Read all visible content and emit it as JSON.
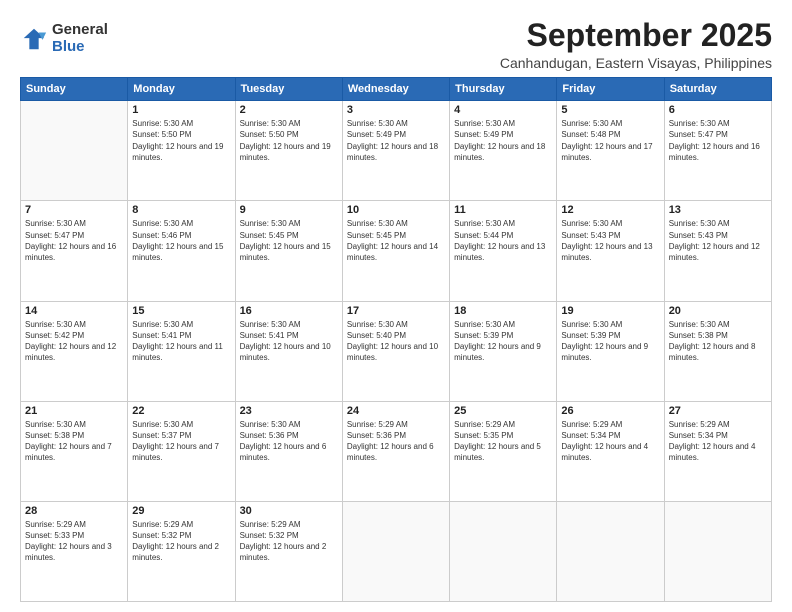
{
  "logo": {
    "general": "General",
    "blue": "Blue"
  },
  "header": {
    "title": "September 2025",
    "subtitle": "Canhandugan, Eastern Visayas, Philippines"
  },
  "days_of_week": [
    "Sunday",
    "Monday",
    "Tuesday",
    "Wednesday",
    "Thursday",
    "Friday",
    "Saturday"
  ],
  "weeks": [
    [
      {
        "day": "",
        "sunrise": "",
        "sunset": "",
        "daylight": ""
      },
      {
        "day": "1",
        "sunrise": "5:30 AM",
        "sunset": "5:50 PM",
        "daylight": "12 hours and 19 minutes."
      },
      {
        "day": "2",
        "sunrise": "5:30 AM",
        "sunset": "5:50 PM",
        "daylight": "12 hours and 19 minutes."
      },
      {
        "day": "3",
        "sunrise": "5:30 AM",
        "sunset": "5:49 PM",
        "daylight": "12 hours and 18 minutes."
      },
      {
        "day": "4",
        "sunrise": "5:30 AM",
        "sunset": "5:49 PM",
        "daylight": "12 hours and 18 minutes."
      },
      {
        "day": "5",
        "sunrise": "5:30 AM",
        "sunset": "5:48 PM",
        "daylight": "12 hours and 17 minutes."
      },
      {
        "day": "6",
        "sunrise": "5:30 AM",
        "sunset": "5:47 PM",
        "daylight": "12 hours and 16 minutes."
      }
    ],
    [
      {
        "day": "7",
        "sunrise": "5:30 AM",
        "sunset": "5:47 PM",
        "daylight": "12 hours and 16 minutes."
      },
      {
        "day": "8",
        "sunrise": "5:30 AM",
        "sunset": "5:46 PM",
        "daylight": "12 hours and 15 minutes."
      },
      {
        "day": "9",
        "sunrise": "5:30 AM",
        "sunset": "5:45 PM",
        "daylight": "12 hours and 15 minutes."
      },
      {
        "day": "10",
        "sunrise": "5:30 AM",
        "sunset": "5:45 PM",
        "daylight": "12 hours and 14 minutes."
      },
      {
        "day": "11",
        "sunrise": "5:30 AM",
        "sunset": "5:44 PM",
        "daylight": "12 hours and 13 minutes."
      },
      {
        "day": "12",
        "sunrise": "5:30 AM",
        "sunset": "5:43 PM",
        "daylight": "12 hours and 13 minutes."
      },
      {
        "day": "13",
        "sunrise": "5:30 AM",
        "sunset": "5:43 PM",
        "daylight": "12 hours and 12 minutes."
      }
    ],
    [
      {
        "day": "14",
        "sunrise": "5:30 AM",
        "sunset": "5:42 PM",
        "daylight": "12 hours and 12 minutes."
      },
      {
        "day": "15",
        "sunrise": "5:30 AM",
        "sunset": "5:41 PM",
        "daylight": "12 hours and 11 minutes."
      },
      {
        "day": "16",
        "sunrise": "5:30 AM",
        "sunset": "5:41 PM",
        "daylight": "12 hours and 10 minutes."
      },
      {
        "day": "17",
        "sunrise": "5:30 AM",
        "sunset": "5:40 PM",
        "daylight": "12 hours and 10 minutes."
      },
      {
        "day": "18",
        "sunrise": "5:30 AM",
        "sunset": "5:39 PM",
        "daylight": "12 hours and 9 minutes."
      },
      {
        "day": "19",
        "sunrise": "5:30 AM",
        "sunset": "5:39 PM",
        "daylight": "12 hours and 9 minutes."
      },
      {
        "day": "20",
        "sunrise": "5:30 AM",
        "sunset": "5:38 PM",
        "daylight": "12 hours and 8 minutes."
      }
    ],
    [
      {
        "day": "21",
        "sunrise": "5:30 AM",
        "sunset": "5:38 PM",
        "daylight": "12 hours and 7 minutes."
      },
      {
        "day": "22",
        "sunrise": "5:30 AM",
        "sunset": "5:37 PM",
        "daylight": "12 hours and 7 minutes."
      },
      {
        "day": "23",
        "sunrise": "5:30 AM",
        "sunset": "5:36 PM",
        "daylight": "12 hours and 6 minutes."
      },
      {
        "day": "24",
        "sunrise": "5:29 AM",
        "sunset": "5:36 PM",
        "daylight": "12 hours and 6 minutes."
      },
      {
        "day": "25",
        "sunrise": "5:29 AM",
        "sunset": "5:35 PM",
        "daylight": "12 hours and 5 minutes."
      },
      {
        "day": "26",
        "sunrise": "5:29 AM",
        "sunset": "5:34 PM",
        "daylight": "12 hours and 4 minutes."
      },
      {
        "day": "27",
        "sunrise": "5:29 AM",
        "sunset": "5:34 PM",
        "daylight": "12 hours and 4 minutes."
      }
    ],
    [
      {
        "day": "28",
        "sunrise": "5:29 AM",
        "sunset": "5:33 PM",
        "daylight": "12 hours and 3 minutes."
      },
      {
        "day": "29",
        "sunrise": "5:29 AM",
        "sunset": "5:32 PM",
        "daylight": "12 hours and 2 minutes."
      },
      {
        "day": "30",
        "sunrise": "5:29 AM",
        "sunset": "5:32 PM",
        "daylight": "12 hours and 2 minutes."
      },
      {
        "day": "",
        "sunrise": "",
        "sunset": "",
        "daylight": ""
      },
      {
        "day": "",
        "sunrise": "",
        "sunset": "",
        "daylight": ""
      },
      {
        "day": "",
        "sunrise": "",
        "sunset": "",
        "daylight": ""
      },
      {
        "day": "",
        "sunrise": "",
        "sunset": "",
        "daylight": ""
      }
    ]
  ]
}
